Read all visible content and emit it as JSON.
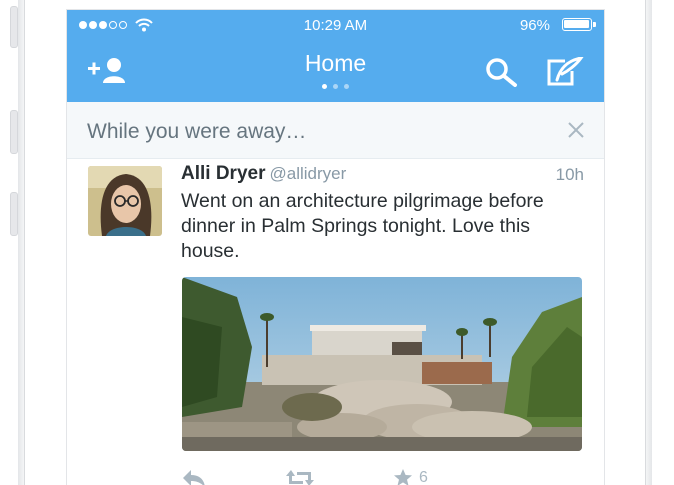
{
  "status_bar": {
    "time": "10:29 AM",
    "battery": "96%",
    "signal_icon": "signal-dots-icon",
    "wifi_icon": "wifi-icon",
    "battery_icon": "battery-icon"
  },
  "nav": {
    "title": "Home",
    "left_icon": "add-user-icon",
    "right_icons": [
      "search-icon",
      "compose-tweet-icon"
    ],
    "page_count": 3,
    "active_page": 1
  },
  "away_banner": {
    "label": "While you were away…",
    "close_icon": "close-icon"
  },
  "tweet": {
    "name": "Alli Dryer",
    "handle": "@allidryer",
    "time": "10h",
    "text": "Went on an architecture pilgrimage before dinner in Palm Springs tonight. Love this house.",
    "favorite_count": "6",
    "action_icons": [
      "reply-icon",
      "retweet-icon",
      "favorite-icon"
    ]
  },
  "colors": {
    "brand_blue": "#55acee",
    "banner_bg": "#f5f8fa",
    "text_dark": "#292f33",
    "text_muted": "#8899a6",
    "icon_muted": "#aab8c2"
  }
}
